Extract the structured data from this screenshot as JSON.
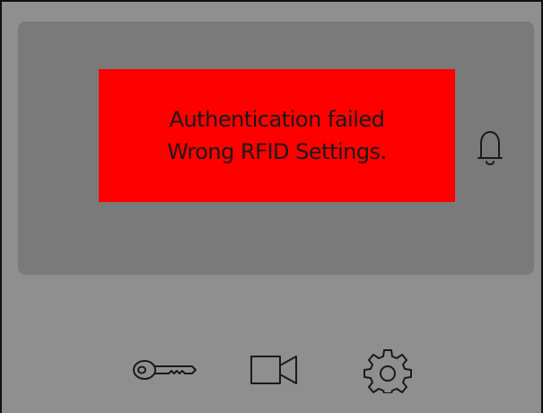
{
  "alert": {
    "line1": "Authentication failed",
    "line2": "Wrong RFID Settings.",
    "background_color": "#ff0000"
  },
  "icons": {
    "notification": "bell-icon",
    "access": "key-icon",
    "video": "video-camera-icon",
    "settings": "gear-icon"
  },
  "colors": {
    "device_background": "#8f8f8f",
    "screen_panel": "#7a7a7a",
    "icon_stroke": "#1a1a1a"
  }
}
